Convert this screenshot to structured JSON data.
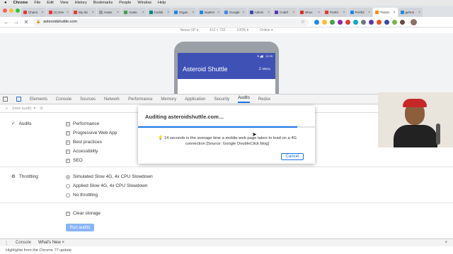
{
  "menubar": {
    "apple": "",
    "app": "Chrome",
    "items": [
      "File",
      "Edit",
      "View",
      "History",
      "Bookmarks",
      "People",
      "Window",
      "Help"
    ]
  },
  "tabs": [
    {
      "label": "Chann",
      "color": "#e53935"
    },
    {
      "label": "(1) Dev",
      "color": "#e53935"
    },
    {
      "label": "My ski",
      "color": "#e53935"
    },
    {
      "label": "Anato",
      "color": "#9e9e9e"
    },
    {
      "label": "Anato",
      "color": "#43a047"
    },
    {
      "label": "Codinl",
      "color": "#00897b"
    },
    {
      "label": "Organ",
      "color": "#1e88e5"
    },
    {
      "label": "Implem",
      "color": "#1e88e5"
    },
    {
      "label": "Google",
      "color": "#4285f4"
    },
    {
      "label": "Admin",
      "color": "#3949ab"
    },
    {
      "label": "Codef",
      "color": "#5e35b1"
    },
    {
      "label": "Inbox",
      "color": "#d93025"
    },
    {
      "label": "Portfo",
      "color": "#e53935"
    },
    {
      "label": "Portfol",
      "color": "#1e88e5"
    },
    {
      "label": "Transc",
      "color": "#fb8c00",
      "active": true
    },
    {
      "label": "gehrm",
      "color": "#1e88e5"
    }
  ],
  "toolbar": {
    "back": "←",
    "forward": "→",
    "reload": "✕",
    "url": "asteroidshuttle.com",
    "lock": "🔒",
    "star": "☆"
  },
  "devicebar": {
    "device": "Nexus 6P ▾",
    "width": "412",
    "times": "×",
    "height": "732",
    "zoom": "100% ▾",
    "network": "Online ▾"
  },
  "phone": {
    "time": "12:29",
    "title": "Asteroid Shuttle",
    "menu": "☰ Menu"
  },
  "devtools": {
    "tabs": [
      "Elements",
      "Console",
      "Sources",
      "Network",
      "Performance",
      "Memory",
      "Application",
      "Security",
      "Audits",
      "Redux"
    ],
    "new_audit": "(new audit)",
    "audits_label": "Audits",
    "audits": [
      "Performance",
      "Progressive Web App",
      "Best practices",
      "Accessibility",
      "SEO"
    ],
    "throttling_label": "Throttling",
    "throttling": [
      "Simulated Slow 4G, 4x CPU Slowdown",
      "Applied Slow 4G, 4x CPU Slowdown",
      "No throttling"
    ],
    "clear_storage": "Clear storage",
    "run_button": "Run audits",
    "drawer_tabs": [
      "Console",
      "What's New"
    ],
    "drawer_close": "×",
    "highlights": "Highlights from the Chrome 77 update"
  },
  "modal": {
    "title": "Auditing asteroidshuttle.com…",
    "progress": 0.9,
    "message": "14 seconds is the average time a mobile web page takes to load on a 4G connection [Source: Google DoubleClick blog]",
    "cancel": "Cancel"
  },
  "colors": {
    "accent": "#1a73e8",
    "phone_header": "#3f51b5"
  }
}
